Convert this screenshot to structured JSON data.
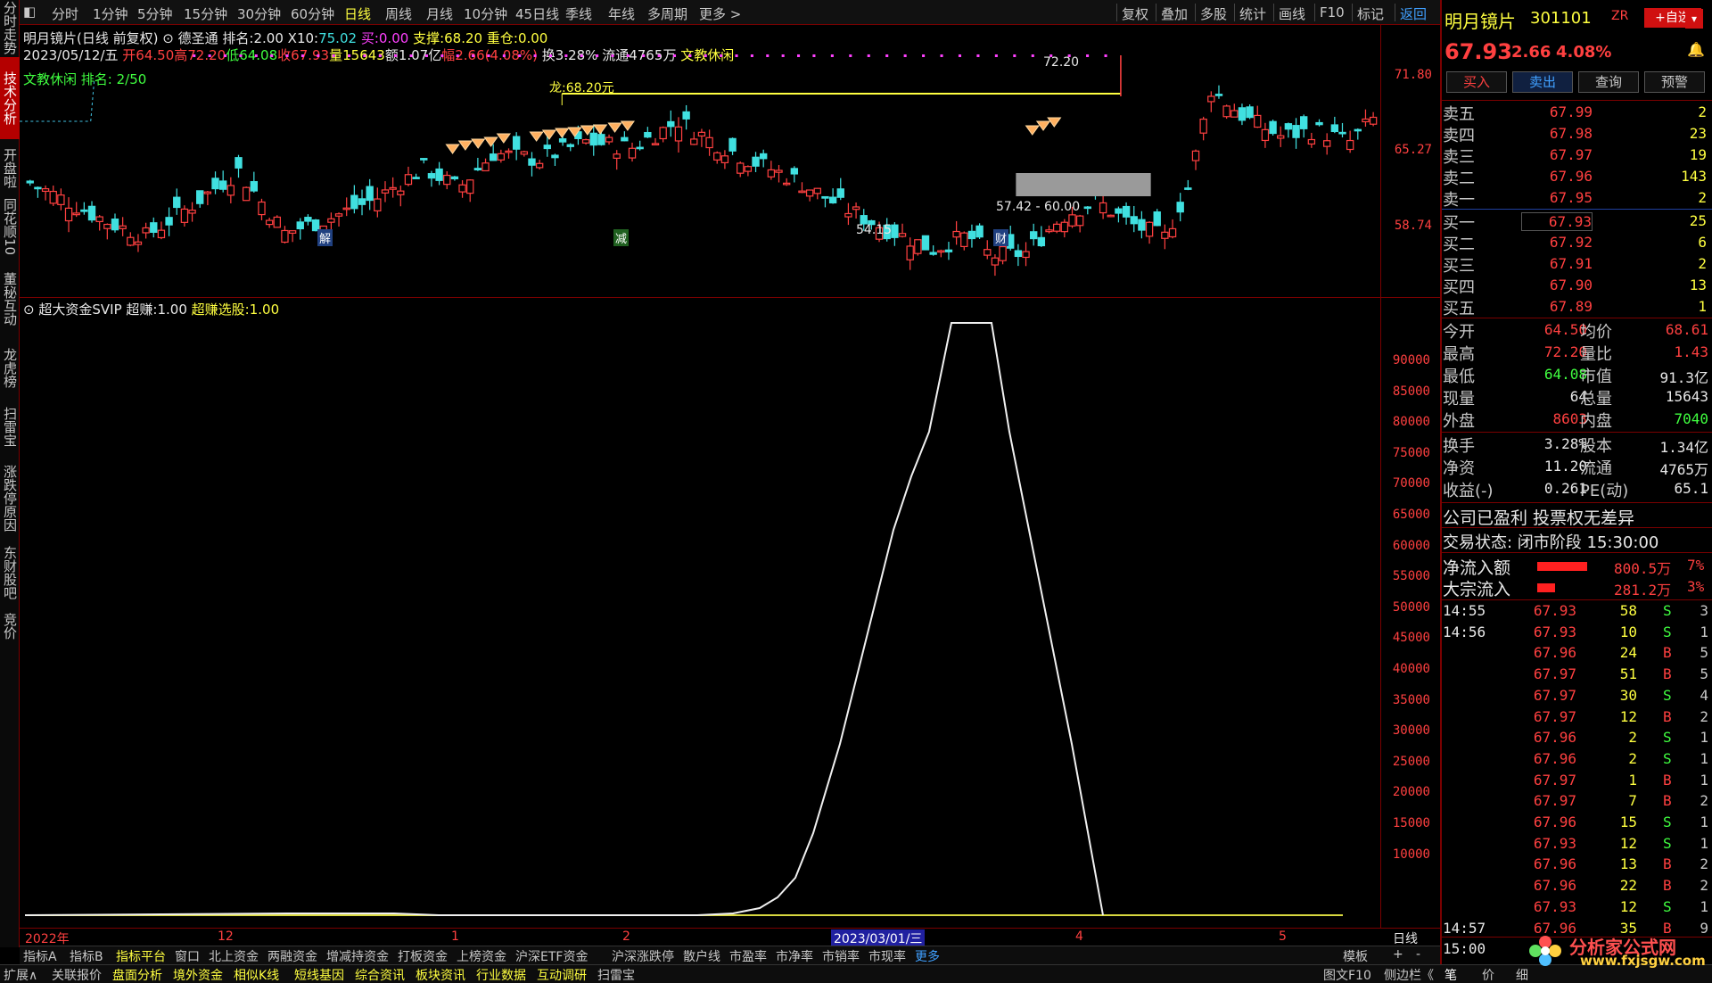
{
  "left_tabs": [
    {
      "label": "分时走势",
      "active": false
    },
    {
      "label": "技术分析",
      "active": true
    },
    {
      "label": "开盘啦",
      "active": false
    },
    {
      "label": "同花顺10",
      "active": false
    },
    {
      "label": "董秘互动",
      "active": false
    },
    {
      "label": "龙虎榜",
      "active": false
    },
    {
      "label": "扫雷宝",
      "active": false
    },
    {
      "label": "涨跌停原因",
      "active": false
    },
    {
      "label": "东财股吧",
      "active": false
    },
    {
      "label": "竞价",
      "active": false
    }
  ],
  "top_bar": {
    "periods": [
      "分时",
      "1分钟",
      "5分钟",
      "15分钟",
      "30分钟",
      "60分钟",
      "日线",
      "周线",
      "月线",
      "10分钟",
      "45日线",
      "季线",
      "年线",
      "多周期",
      "更多 >"
    ],
    "active_period": "日线",
    "tools": [
      "复权",
      "叠加",
      "多股",
      "统计",
      "画线",
      "F10",
      "标记",
      "返回"
    ]
  },
  "info": {
    "stock_title": "明月镜片(日线 前复权)",
    "desheng": "德圣通",
    "rank_label": "排名:",
    "rank_value": "2.00",
    "x10_label": "X10:",
    "x10_value": "75.02",
    "buy_label": "买:",
    "buy_value": "0.00",
    "support_label": "支撑:",
    "support_value": "68.20",
    "heavy_label": "重仓:",
    "heavy_value": "0.00",
    "date": "2023/05/12/五",
    "open": "开64.50",
    "high": "高72.20",
    "low": "低64.08",
    "close": "收67.93",
    "vol": "量15643",
    "amount": "额1.07亿",
    "range": "幅2.66(4.08%)",
    "turnover": "换3.28%",
    "float": "流通4765万",
    "sector": "文教休闲",
    "sector_rank": "文教休闲 排名: 2/50"
  },
  "price_axis": [
    "71.80",
    "65.27",
    "58.74"
  ],
  "annotations": {
    "dragon": "龙:68.20元",
    "high_mark": "72.20",
    "low_mark": "54.15",
    "range_mark": "57.42 - 60.00",
    "tag_jie": "解",
    "tag_jian": "减",
    "tag_cai": "财"
  },
  "indicator": {
    "name": "超大资金SVIP",
    "item1_label": "超赚:",
    "item1_value": "1.00",
    "item2_label": "超赚选股:",
    "item2_value": "1.00"
  },
  "vol_axis": [
    "90000",
    "85000",
    "80000",
    "75000",
    "70000",
    "65000",
    "60000",
    "55000",
    "50000",
    "45000",
    "40000",
    "35000",
    "30000",
    "25000",
    "20000",
    "15000",
    "10000"
  ],
  "date_axis": [
    {
      "label": "2022年",
      "highlight": false
    },
    {
      "label": "12",
      "highlight": false
    },
    {
      "label": "1",
      "highlight": false
    },
    {
      "label": "2",
      "highlight": false
    },
    {
      "label": "2023/03/01/三",
      "highlight": true
    },
    {
      "label": "4",
      "highlight": false
    },
    {
      "label": "5",
      "highlight": false
    },
    {
      "label": "日线",
      "highlight": false
    }
  ],
  "bottom_tabs1": [
    "指标A",
    "指标B",
    "指标平台",
    "窗口",
    "北上资金",
    "两融资金",
    "增减持资金",
    "打板资金",
    "上榜资金",
    "沪深ETF资金",
    "沪深涨跌停",
    "散户线",
    "市盈率",
    "市净率",
    "市销率",
    "市现率",
    "更多"
  ],
  "bottom_tabs1_right": [
    "模板",
    "+",
    "-"
  ],
  "bottom_tabs2": [
    "扩展∧",
    "关联报价",
    "盘面分析",
    "境外资金",
    "相似K线",
    "短线基因",
    "综合资讯",
    "板块资讯",
    "行业数据",
    "互动调研",
    "扫雷宝"
  ],
  "bottom_tabs2_right": [
    "图文F10",
    "侧边栏《",
    "笔",
    "价",
    "细"
  ],
  "right_panel": {
    "name": "明月镜片",
    "code": "301101",
    "tag": "ZR",
    "add_fav": "+自选",
    "price": "67.93",
    "change": "2.66",
    "pct": "4.08%",
    "buttons": [
      "买入",
      "卖出",
      "查询",
      "预警"
    ],
    "asks": [
      {
        "label": "卖五",
        "price": "67.99",
        "qty": "2"
      },
      {
        "label": "卖四",
        "price": "67.98",
        "qty": "23"
      },
      {
        "label": "卖三",
        "price": "67.97",
        "qty": "19"
      },
      {
        "label": "卖二",
        "price": "67.96",
        "qty": "143"
      },
      {
        "label": "卖一",
        "price": "67.95",
        "qty": "2"
      }
    ],
    "bids": [
      {
        "label": "买一",
        "price": "67.93",
        "qty": "25"
      },
      {
        "label": "买二",
        "price": "67.92",
        "qty": "6"
      },
      {
        "label": "买三",
        "price": "67.91",
        "qty": "2"
      },
      {
        "label": "买四",
        "price": "67.90",
        "qty": "13"
      },
      {
        "label": "买五",
        "price": "67.89",
        "qty": "1"
      }
    ],
    "stats": [
      {
        "l1": "今开",
        "v1": "64.50",
        "c1": "#ff4040",
        "l2": "均价",
        "v2": "68.61",
        "c2": "#ff4040"
      },
      {
        "l1": "最高",
        "v1": "72.20",
        "c1": "#ff4040",
        "l2": "量比",
        "v2": "1.43",
        "c2": "#ff4040"
      },
      {
        "l1": "最低",
        "v1": "64.08",
        "c1": "#40ff40",
        "l2": "市值",
        "v2": "91.3亿",
        "c2": "#e8e8e8"
      },
      {
        "l1": "现量",
        "v1": "64",
        "c1": "#e8e8e8",
        "l2": "总量",
        "v2": "15643",
        "c2": "#e8e8e8"
      },
      {
        "l1": "外盘",
        "v1": "8603",
        "c1": "#ff4040",
        "l2": "内盘",
        "v2": "7040",
        "c2": "#40ff40"
      }
    ],
    "stats2": [
      {
        "l1": "换手",
        "v1": "3.28%",
        "c1": "#e8e8e8",
        "l2": "股本",
        "v2": "1.34亿",
        "c2": "#e8e8e8"
      },
      {
        "l1": "净资",
        "v1": "11.20",
        "c1": "#e8e8e8",
        "l2": "流通",
        "v2": "4765万",
        "c2": "#e8e8e8"
      },
      {
        "l1": "收益(-)",
        "v1": "0.261",
        "c1": "#e8e8e8",
        "l2": "PE(动)",
        "v2": "65.1",
        "c2": "#e8e8e8"
      }
    ],
    "company_note": "公司已盈利 投票权无差异",
    "trade_status": "交易状态: 闭市阶段 15:30:00",
    "net_inflow_label": "净流入额",
    "net_inflow_value": "800.5万",
    "net_inflow_pct": "7%",
    "net_inflow_fill": 0.85,
    "block_inflow_label": "大宗流入",
    "block_inflow_value": "281.2万",
    "block_inflow_pct": "3%",
    "block_inflow_fill": 0.3,
    "ticks": [
      {
        "t": "14:55",
        "p": "67.93",
        "v": "58",
        "d": "S",
        "n": "3"
      },
      {
        "t": "14:56",
        "p": "67.93",
        "v": "10",
        "d": "S",
        "n": "1"
      },
      {
        "t": "",
        "p": "67.96",
        "v": "24",
        "d": "B",
        "n": "5"
      },
      {
        "t": "",
        "p": "67.97",
        "v": "51",
        "d": "B",
        "n": "5"
      },
      {
        "t": "",
        "p": "67.97",
        "v": "30",
        "d": "S",
        "n": "4"
      },
      {
        "t": "",
        "p": "67.97",
        "v": "12",
        "d": "B",
        "n": "2"
      },
      {
        "t": "",
        "p": "67.96",
        "v": "2",
        "d": "S",
        "n": "1"
      },
      {
        "t": "",
        "p": "67.96",
        "v": "2",
        "d": "S",
        "n": "1"
      },
      {
        "t": "",
        "p": "67.97",
        "v": "1",
        "d": "B",
        "n": "1"
      },
      {
        "t": "",
        "p": "67.97",
        "v": "7",
        "d": "B",
        "n": "2"
      },
      {
        "t": "",
        "p": "67.96",
        "v": "15",
        "d": "S",
        "n": "1"
      },
      {
        "t": "",
        "p": "67.93",
        "v": "12",
        "d": "S",
        "n": "1"
      },
      {
        "t": "",
        "p": "67.96",
        "v": "13",
        "d": "B",
        "n": "2"
      },
      {
        "t": "",
        "p": "67.96",
        "v": "22",
        "d": "B",
        "n": "2"
      },
      {
        "t": "",
        "p": "67.93",
        "v": "12",
        "d": "S",
        "n": "1"
      },
      {
        "t": "14:57",
        "p": "67.96",
        "v": "35",
        "d": "B",
        "n": "9"
      },
      {
        "t": "15:00",
        "p": "",
        "v": "",
        "d": "",
        "n": ""
      }
    ]
  },
  "watermark": {
    "line1": "分析家公式网",
    "line2": "www.fxjsgw.com"
  },
  "colors": {
    "up": "#ff4040",
    "down": "#40e0e0",
    "yellow": "#ffff40",
    "border": "#7a0000"
  }
}
